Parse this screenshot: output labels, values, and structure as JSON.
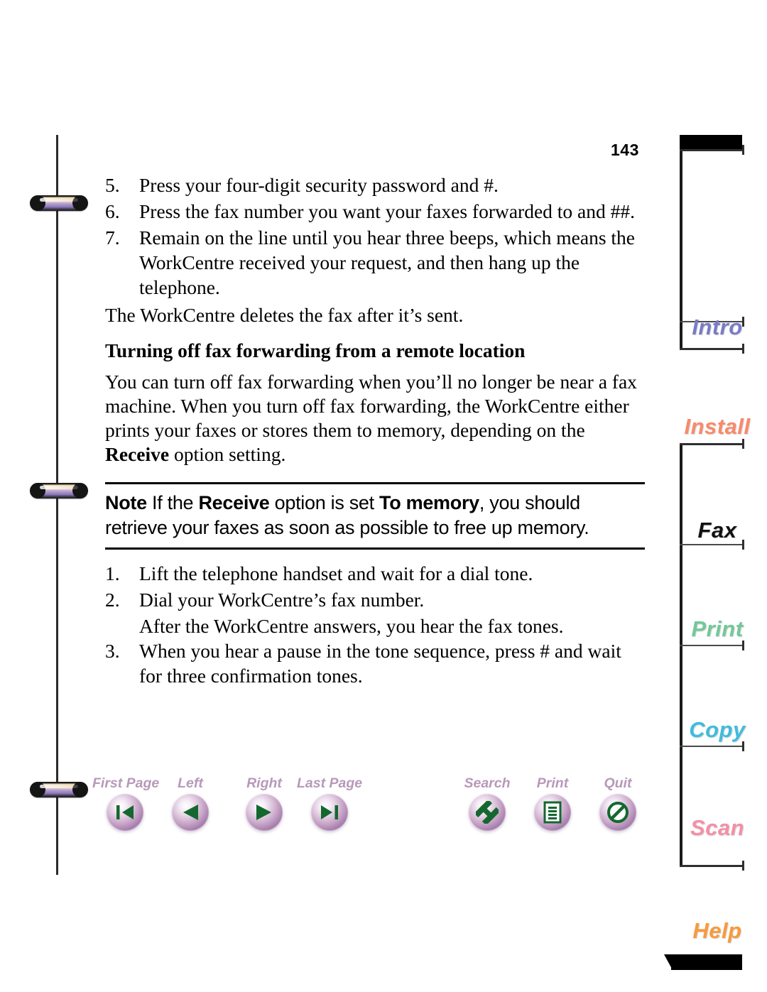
{
  "page": {
    "number": "143"
  },
  "content": {
    "upper_steps": [
      {
        "num": "5.",
        "text": "Press your four-digit security password and #."
      },
      {
        "num": "6.",
        "text": "Press the fax number you want your faxes forwarded to and ##."
      },
      {
        "num": "7.",
        "text": "Remain on the line until you hear three beeps, which means the WorkCentre received your request, and then hang up the telephone."
      }
    ],
    "after_steps_text": "The WorkCentre deletes the fax after it’s sent.",
    "section_heading": "Turning off fax forwarding from a remote location",
    "body_paragraph": {
      "before": "You can turn off fax forwarding when you’ll no longer be near a fax machine. When you turn off fax forwarding, the WorkCentre either prints your faxes or stores them to memory, depending on the ",
      "bold": "Receive",
      "after": " option setting."
    },
    "note": {
      "label": "Note",
      "part1": " If the ",
      "bold1": "Receive",
      "part2": " option is set ",
      "bold2": "To memory",
      "part3": ", you should retrieve your faxes as soon as possible to free up memory."
    },
    "lower_steps": [
      {
        "num": "1.",
        "text": "Lift the telephone handset and wait for a dial tone."
      },
      {
        "num": "2.",
        "text": "Dial your WorkCentre’s fax number."
      }
    ],
    "lower_note": "After the WorkCentre answers, you hear the fax tones.",
    "lower_steps_2": [
      {
        "num": "3.",
        "text": "When you hear a pause in the tone sequence, press # and wait for three confirmation tones."
      }
    ]
  },
  "navigation": {
    "label_color": "#b799b9",
    "glyph_color": "#14682f",
    "buttons": [
      {
        "label": "First Page",
        "icon": "first-page-icon"
      },
      {
        "label": "Left",
        "icon": "previous-page-icon"
      },
      {
        "label": "Right",
        "icon": "next-page-icon"
      },
      {
        "label": "Last Page",
        "icon": "last-page-icon"
      },
      {
        "label": "Search",
        "icon": "search-icon"
      },
      {
        "label": "Print",
        "icon": "print-icon"
      },
      {
        "label": "Quit",
        "icon": "quit-icon"
      }
    ]
  },
  "tabs": [
    {
      "label": "Intro",
      "color": "#7a7ac8",
      "active": false
    },
    {
      "label": "Install",
      "color": "#f98a6a",
      "active": false
    },
    {
      "label": "Fax",
      "color": "#111111",
      "active": true
    },
    {
      "label": "Print",
      "color": "#73c89a",
      "active": false
    },
    {
      "label": "Copy",
      "color": "#3fbcdd",
      "active": false
    },
    {
      "label": "Scan",
      "color": "#f58fa8",
      "active": false
    },
    {
      "label": "Help",
      "color": "#f89a3c",
      "active": false
    }
  ]
}
